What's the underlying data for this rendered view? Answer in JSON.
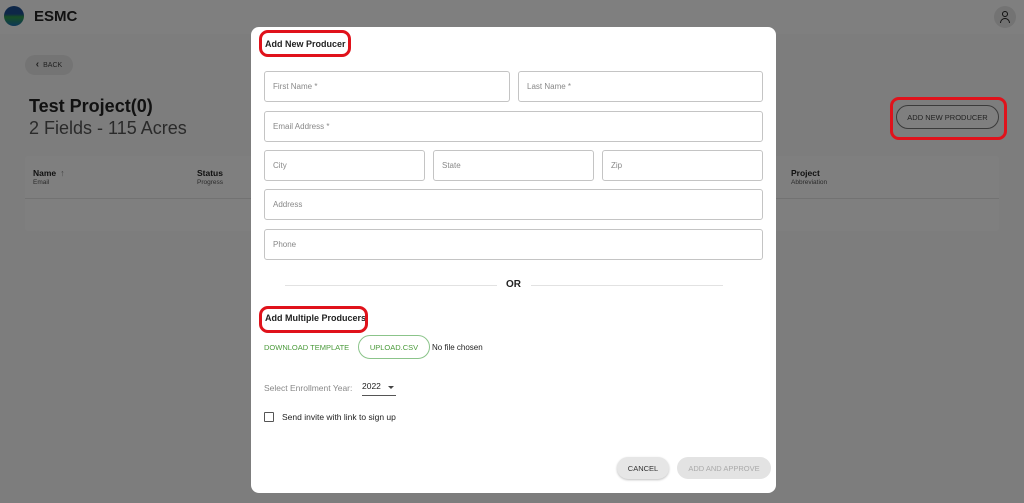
{
  "app": {
    "brand": "ESMC",
    "back_label": "BACK",
    "project_title": "Test Project(0)",
    "project_subtitle": "2 Fields - 115 Acres",
    "add_new_producer_label": "ADD NEW PRODUCER",
    "table": {
      "columns": [
        {
          "label": "Name",
          "sub": "Email",
          "sortable": true
        },
        {
          "label": "Status",
          "sub": "Progress"
        },
        {
          "label": "Project",
          "sub": "Abbreviation"
        }
      ]
    }
  },
  "modal": {
    "title": "Add New Producer",
    "fields": {
      "first_name": "First Name *",
      "last_name": "Last Name *",
      "email": "Email Address *",
      "city": "City",
      "state": "State",
      "zip": "Zip",
      "address": "Address",
      "phone": "Phone"
    },
    "or_label": "OR",
    "multi_title": "Add Multiple Producers",
    "download_template_label": "DOWNLOAD TEMPLATE",
    "upload_label": "UPLOAD.CSV",
    "no_file_label": "No file chosen",
    "year_label": "Select Enrollment Year:",
    "year_value": "2022",
    "invite_label": "Send invite with link to sign up",
    "cancel_label": "CANCEL",
    "approve_label": "ADD AND APPROVE"
  },
  "colors": {
    "highlight": "#e0121b",
    "link_green": "#4a9a3a"
  },
  "icons": {
    "back": "chevron-left-icon",
    "user": "user-icon",
    "sort": "arrow-up-icon",
    "dropdown": "caret-down-icon"
  }
}
